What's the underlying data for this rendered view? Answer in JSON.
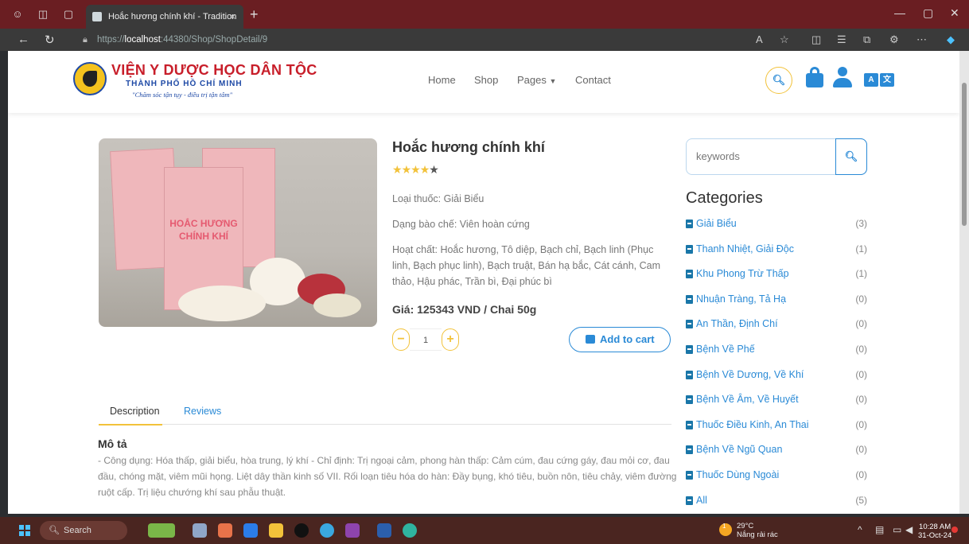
{
  "browser": {
    "tab_title": "Hoắc hương chính khí - Tradition",
    "tab_close": "×",
    "new_tab": "+",
    "url_prefix": "https://",
    "url_host": "localhost",
    "url_rest": ":44380/Shop/ShopDetail/9"
  },
  "site": {
    "logo_line1": "VIỆN Y DƯỢC HỌC DÂN TỘC",
    "logo_line2": "THÀNH PHỐ HỒ CHÍ MINH",
    "logo_line3": "\"Chăm sóc tận tụy - điều trị tận tâm\"",
    "menu": [
      "Home",
      "Shop",
      "Pages",
      "Contact"
    ],
    "translate_label": "A"
  },
  "product": {
    "title": "Hoắc hương chính khí",
    "rating": 4,
    "rating_max": 5,
    "type": "Loại thuốc: Giải Biểu",
    "form": "Dạng bào chế: Viên hoàn cứng",
    "ingredients": "Hoạt chất: Hoắc hương, Tô diệp, Bạch chỉ, Bạch linh (Phục linh, Bạch phục linh), Bạch truật, Bán hạ bắc, Cát cánh, Cam thảo, Hậu phác, Trần bì, Đại phúc bì",
    "price": "Giá: 125343 VND / Chai 50g",
    "quantity": "1",
    "minus": "−",
    "plus": "+",
    "add_to_cart": "Add to cart",
    "box_text": "HOẮC HƯƠNG CHÍNH KHÍ"
  },
  "tabs": {
    "description": "Description",
    "reviews": "Reviews"
  },
  "description": {
    "heading": "Mô tả",
    "body": "- Công dụng: Hóa thấp, giải biểu, hòa trung, lý khí - Chỉ định: Trị ngoại cảm, phong hàn thấp: Cảm cúm, đau cứng gáy, đau mỏi cơ, đau đầu, chóng mặt, viêm mũi họng. Liệt dây thần kinh số VII. Rối loạn tiêu hóa do hàn: Đầy bụng, khó tiêu, buồn nôn, tiêu chảy, viêm đường ruột cấp. Trị liệu chướng khí sau phẫu thuật."
  },
  "sidebar": {
    "search_placeholder": "keywords",
    "categories_title": "Categories",
    "categories": [
      {
        "name": "Giải Biểu",
        "count": "(3)"
      },
      {
        "name": "Thanh Nhiệt, Giải Độc",
        "count": "(1)"
      },
      {
        "name": "Khu Phong Trừ Thấp",
        "count": "(1)"
      },
      {
        "name": "Nhuận Tràng, Tả Hạ",
        "count": "(0)"
      },
      {
        "name": "An Thần, Định Chí",
        "count": "(0)"
      },
      {
        "name": "Bệnh Về Phế",
        "count": "(0)"
      },
      {
        "name": "Bệnh Về Dương, Về Khí",
        "count": "(0)"
      },
      {
        "name": "Bệnh Về Âm, Về Huyết",
        "count": "(0)"
      },
      {
        "name": "Thuốc Điều Kinh, An Thai",
        "count": "(0)"
      },
      {
        "name": "Bệnh Về Ngũ Quan",
        "count": "(0)"
      },
      {
        "name": "Thuốc Dùng Ngoài",
        "count": "(0)"
      },
      {
        "name": "All",
        "count": "(5)"
      }
    ]
  },
  "taskbar": {
    "search": "Search",
    "temperature": "29°C",
    "weather": "Nắng rải rác",
    "weather_badge": "1",
    "time": "10:28 AM",
    "date": "31-Oct-24"
  },
  "colors": {
    "accent_blue": "#2a8ad6",
    "accent_yellow": "#f2c23a",
    "logo_red": "#c81e2a"
  }
}
